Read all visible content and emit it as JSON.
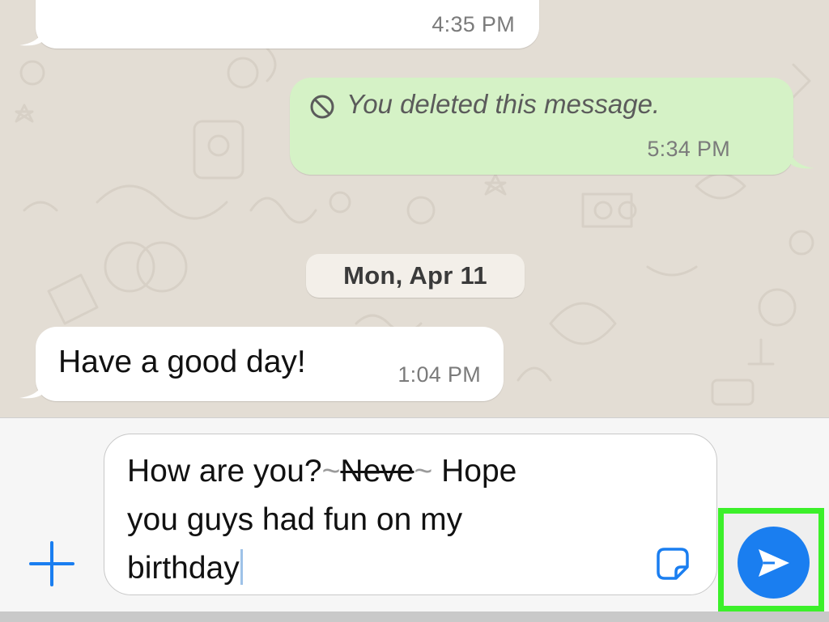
{
  "colors": {
    "chat_background": "#e3ddd4",
    "incoming_bubble": "#ffffff",
    "outgoing_bubble": "#d5f2c6",
    "accent_blue": "#1a7ef0",
    "highlight_green": "#3cf02a"
  },
  "messages": [
    {
      "direction": "incoming",
      "text": "",
      "time": "4:35 PM"
    },
    {
      "direction": "outgoing",
      "icon": "blocked-icon",
      "text": "You deleted this message.",
      "time": "5:34 PM"
    },
    {
      "direction": "incoming",
      "text": "Have a good day!",
      "time": "1:04 PM"
    }
  ],
  "date_separator": "Mon, Apr 11",
  "composer": {
    "text_before_strike": "How are you?",
    "strike_open": "~",
    "strike_text": "Neve",
    "strike_close": "~",
    "text_after_strike": " Hope\nyou guys had fun on my\nbirthday",
    "plus_icon": "plus-icon",
    "sticker_icon": "sticker-icon",
    "send_icon": "send-icon"
  }
}
